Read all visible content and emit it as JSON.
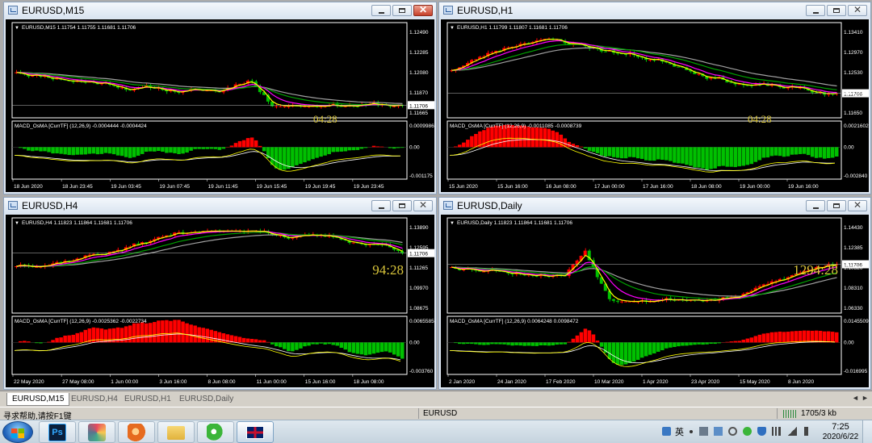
{
  "windows": [
    {
      "title": "EURUSD,M15",
      "info": "EURUSD,M15  1.11754 1.11755 1.11681 1.11706",
      "price_labels": [
        "1.12490",
        "1.12285",
        "1.12080",
        "1.11870",
        "1.11665"
      ],
      "current_price": "1.11706",
      "countdown": "04:28",
      "macd_info": "MACD_OsMA [CurrTF] (12,26,9) -0.0004444 -0.0004424",
      "macd_labels": [
        "0.0009986",
        "0.00",
        "-0.001175"
      ],
      "time_labels": [
        "18 Jun 2020",
        "18 Jun 23:45",
        "19 Jun 03:45",
        "19 Jun 07:45",
        "19 Jun 11:45",
        "19 Jun 15:45",
        "19 Jun 19:45",
        "19 Jun 23:45"
      ],
      "has_close": true
    },
    {
      "title": "EURUSD,H1",
      "info": "EURUSD,H1  1.11799 1.11807 1.11681 1.11706",
      "price_labels": [
        "1.13410",
        "1.12970",
        "1.12530",
        "1.12090",
        "1.11650"
      ],
      "current_price": "1.11706",
      "countdown": "04:28",
      "macd_info": "MACD_OsMA [CurrTF] (12,26,9) -0.0011085 -0.0008739",
      "macd_labels": [
        "0.0021602",
        "0.00",
        "-0.002840"
      ],
      "time_labels": [
        "15 Jun 2020",
        "15 Jun 16:00",
        "16 Jun 08:00",
        "17 Jun 00:00",
        "17 Jun 16:00",
        "18 Jun 08:00",
        "19 Jun 00:00",
        "19 Jun 16:00"
      ],
      "has_close": false
    },
    {
      "title": "EURUSD,H4",
      "info": "EURUSD,H4  1.11823 1.11864 1.11681 1.11706",
      "price_labels": [
        "1.13890",
        "1.12595",
        "1.11265",
        "1.09970",
        "1.08675"
      ],
      "current_price": "1.11706",
      "countdown": "94:28",
      "macd_info": "MACD_OsMA [CurrTF] (12,26,9) -0.0025362 -0.0022734",
      "macd_labels": [
        "0.0065585",
        "0.00",
        "-0.003760"
      ],
      "time_labels": [
        "22 May 2020",
        "27 May 08:00",
        "1 Jun 00:00",
        "3 Jun 16:00",
        "8 Jun 08:00",
        "11 Jun 00:00",
        "15 Jun 16:00",
        "18 Jun 08:00"
      ],
      "has_close": false
    },
    {
      "title": "EURUSD,Daily",
      "info": "EURUSD,Daily  1.11823 1.11864 1.11681 1.11706",
      "price_labels": [
        "1.14430",
        "1.12385",
        "1.10320",
        "1.08310",
        "1.06330"
      ],
      "current_price": "1.11706",
      "countdown": "1294:28",
      "macd_info": "MACD_OsMA [CurrTF] (12,26,9) 0.0064248 0.0098472",
      "macd_labels": [
        "0.0145509",
        "0.00",
        "-0.016995"
      ],
      "time_labels": [
        "2 Jan 2020",
        "24 Jan 2020",
        "17 Feb 2020",
        "10 Mar 2020",
        "1 Apr 2020",
        "23 Apr 2020",
        "15 May 2020",
        "8 Jun 2020"
      ],
      "has_close": false
    }
  ],
  "tabs": [
    "EURUSD,M15",
    "EURUSD,H4",
    "EURUSD,H1",
    "EURUSD,Daily"
  ],
  "active_tab": 0,
  "tab_arrows": [
    "◄",
    "►"
  ],
  "status": {
    "help": "寻求帮助,请按F1键",
    "symbol": "EURUSD",
    "traffic": "1705/3 kb"
  },
  "taskbar": {
    "apps": [
      "photoshop-icon",
      "paint-icon",
      "browser-icon",
      "folder-icon",
      "wechat-icon",
      "union-jack-icon"
    ],
    "tray_lang": "英",
    "clock_time": "7:25",
    "clock_date": "2020/6/22"
  },
  "icons": {
    "close": "✕",
    "dropdown": "▼"
  },
  "colors": {
    "bull": "#ff0000",
    "bear": "#00c000",
    "ma_fast": "#ffff00",
    "ma_mid": "#ff00ff",
    "ma_slow": "#00a000",
    "ma_long": "#a0a0a0",
    "countdown": "#d9c53b"
  }
}
